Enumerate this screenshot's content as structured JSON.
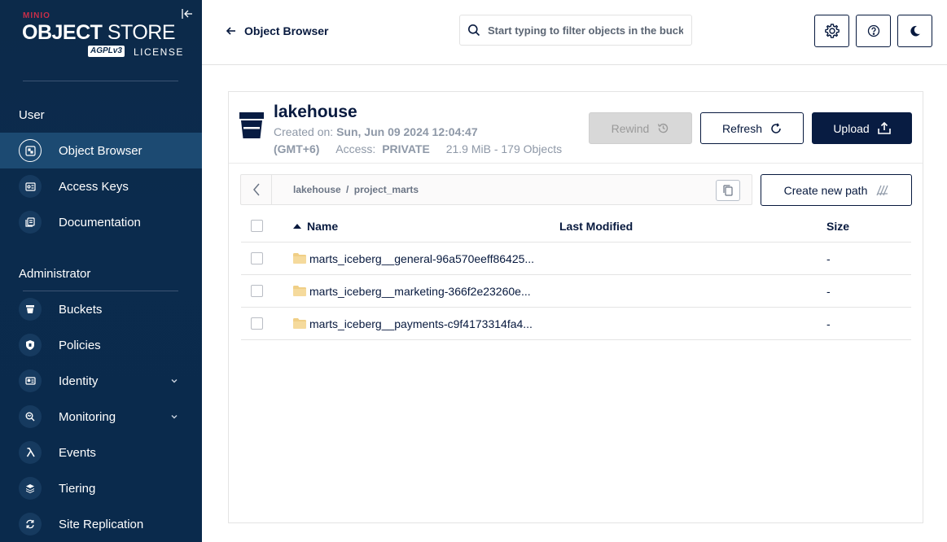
{
  "sidebar": {
    "logo_brand": "MINIO",
    "logo_object": "OBJECT",
    "logo_store": "STORE",
    "logo_agpl": "AGPLv3",
    "logo_license": "LICENSE",
    "section_user": "User",
    "section_admin": "Administrator",
    "items_user": [
      {
        "label": "Object Browser",
        "icon": "object-browser-icon",
        "active": true
      },
      {
        "label": "Access Keys",
        "icon": "access-keys-icon"
      },
      {
        "label": "Documentation",
        "icon": "documentation-icon"
      }
    ],
    "items_admin": [
      {
        "label": "Buckets",
        "icon": "buckets-icon"
      },
      {
        "label": "Policies",
        "icon": "policies-icon"
      },
      {
        "label": "Identity",
        "icon": "identity-icon",
        "expandable": true
      },
      {
        "label": "Monitoring",
        "icon": "monitoring-icon",
        "expandable": true
      },
      {
        "label": "Events",
        "icon": "lambda-icon"
      },
      {
        "label": "Tiering",
        "icon": "tiering-icon"
      },
      {
        "label": "Site Replication",
        "icon": "replication-icon"
      }
    ]
  },
  "header": {
    "back_title": "Object Browser",
    "search_placeholder": "Start typing to filter objects in the bucket"
  },
  "bucket": {
    "name": "lakehouse",
    "created_label": "Created on:",
    "created_value": "Sun, Jun 09 2024 12:04:47",
    "timezone": "(GMT+6)",
    "access_label": "Access:",
    "access_value": "PRIVATE",
    "stats": "21.9 MiB - 179 Objects"
  },
  "actions": {
    "rewind": "Rewind",
    "refresh": "Refresh",
    "upload": "Upload",
    "create_path": "Create new path"
  },
  "path": {
    "bucket": "lakehouse",
    "separator": "/",
    "folder": "project_marts"
  },
  "table": {
    "columns": {
      "name": "Name",
      "modified": "Last Modified",
      "size": "Size"
    },
    "rows": [
      {
        "name": "marts_iceberg__general-96a570eeff86425...",
        "modified": "",
        "size": "-"
      },
      {
        "name": "marts_iceberg__marketing-366f2e23260e...",
        "modified": "",
        "size": "-"
      },
      {
        "name": "marts_iceberg__payments-c9f4173314fa4...",
        "modified": "",
        "size": "-"
      }
    ]
  },
  "colors": {
    "sidebar_bg": "#0c2a4a",
    "active_item_bg": "#1c4a72",
    "primary_dark": "#081c42",
    "brand_red": "#c72e49",
    "folder_yellow": "#f0cf86"
  }
}
